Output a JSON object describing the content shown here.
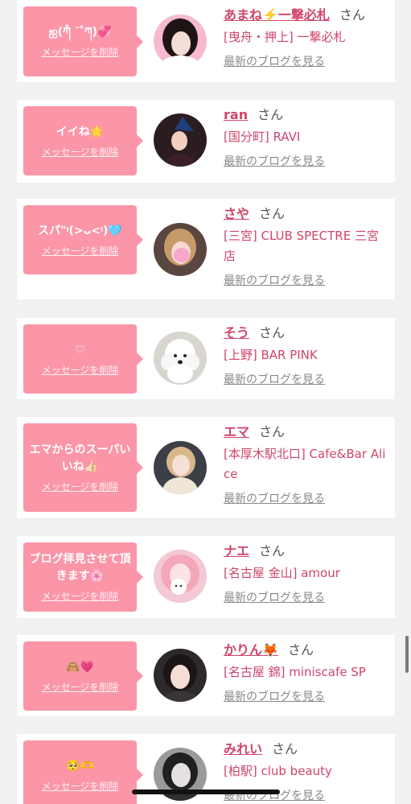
{
  "colors": {
    "bubble": "#fb95a8",
    "accent": "#d0456a",
    "background": "#f1f1f1",
    "card": "#ffffff",
    "muted": "#888888"
  },
  "feed": {
    "delete_label": "メッセージを削除",
    "honorific": "さん",
    "blog_link_label": "最新のブログを見る",
    "items": [
      {
        "message": "ஐ(ཀ̊ ˘ ̊ཀ)💞",
        "name": "あまね⚡️一撃必札",
        "shop": "[曳舟・押上] 一撃必札"
      },
      {
        "message": "イイね🌟",
        "name": "ran",
        "shop": "[国分町] RAVI"
      },
      {
        "message": "スパ\"ᵎ(>ᴗ<ᵎ)🩵",
        "name": "さや",
        "shop": "[三宮] CLUB SPECTRE 三宮店"
      },
      {
        "message": "♡",
        "name": "そう",
        "shop": "[上野] BAR PINK"
      },
      {
        "message": "エマからのスーパいいね👍🏻",
        "name": "エマ",
        "shop": "[本厚木駅北口] Cafe&Bar Alice"
      },
      {
        "message": "ブログ拝見させて頂きます🌸",
        "name": "ナエ",
        "shop": "[名古屋 金山] amour"
      },
      {
        "message": "🙈💗",
        "name": "かりん🦊",
        "shop": "[名古屋 錦] miniscafe SP"
      },
      {
        "message": "🥺🫶",
        "name": "みれい",
        "shop": "[柏駅] club beauty"
      }
    ]
  }
}
